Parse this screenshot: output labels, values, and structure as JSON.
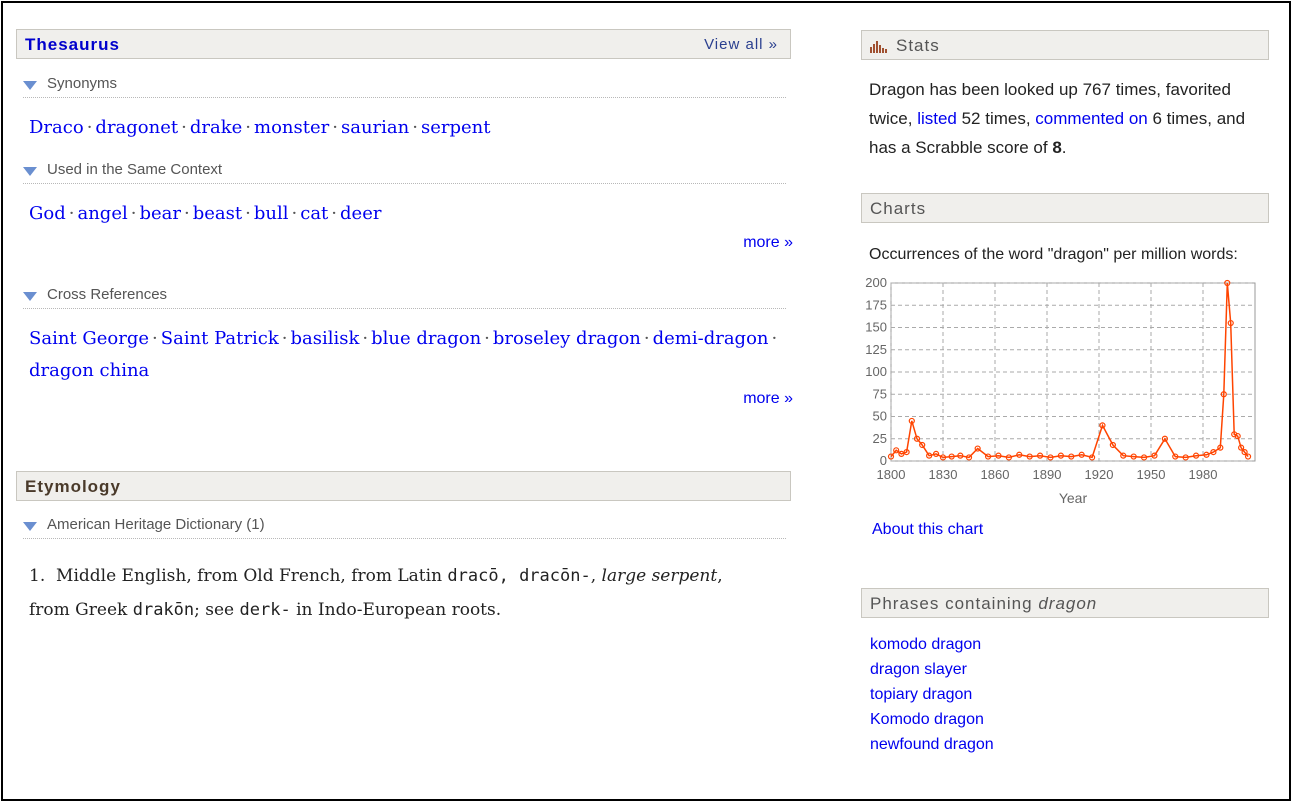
{
  "thesaurus": {
    "title": "Thesaurus",
    "view_all": "View all »",
    "synonyms_label": "Synonyms",
    "synonyms": [
      "Draco",
      "dragonet",
      "drake",
      "monster",
      "saurian",
      "serpent"
    ],
    "context_label": "Used in the Same Context",
    "context": [
      "God",
      "angel",
      "bear",
      "beast",
      "bull",
      "cat",
      "deer"
    ],
    "more_label": "more »",
    "xref_label": "Cross References",
    "xref_line1": [
      "Saint George",
      "Saint Patrick",
      "basilisk",
      "blue dragon",
      "broseley dragon",
      "demi-dragon"
    ],
    "xref_line2": [
      "dragon china"
    ],
    "more_label_2": "more »"
  },
  "etymology": {
    "title": "Etymology",
    "source_label": "American Heritage Dictionary (1)",
    "item_number": "1.",
    "part1": "Middle English, from Old French, from Latin ",
    "latin": "dracō, dracōn-",
    "part2": ", ",
    "gloss": "large serpent",
    "part3": ", from Greek ",
    "greek": "drakōn",
    "part4": "; see ",
    "root": "derk-",
    "part5": " in Indo-European roots."
  },
  "stats": {
    "title": "Stats",
    "text1": "Dragon has been looked up 767 times, favorited twice, ",
    "listed_link": "listed",
    "text2": " 52 times, ",
    "commented_link": "commented on",
    "text3": " 6 times, and has a Scrabble score of ",
    "score": "8",
    "text4": "."
  },
  "charts": {
    "title": "Charts",
    "caption": "Occurrences of the word \"dragon\" per million words:",
    "about_link": "About this chart"
  },
  "phrases": {
    "title_prefix": "Phrases containing ",
    "title_word": "dragon",
    "items": [
      "komodo dragon",
      "dragon slayer",
      "topiary dragon",
      "Komodo dragon",
      "newfound dragon"
    ]
  },
  "colors": {
    "link": "#0000ee",
    "chart_line": "#ff4400",
    "header_bg": "#f0efec"
  },
  "chart_data": {
    "type": "line",
    "xlabel": "Year",
    "ylabel": "",
    "xlim": [
      1800,
      2010
    ],
    "ylim": [
      0,
      200
    ],
    "xticks": [
      1800,
      1830,
      1860,
      1890,
      1920,
      1950,
      1980
    ],
    "yticks": [
      0,
      25,
      50,
      75,
      100,
      125,
      150,
      175,
      200
    ],
    "grid": true,
    "series": [
      {
        "x": [
          1800,
          1803,
          1806,
          1809,
          1812,
          1815,
          1818,
          1822,
          1826,
          1830,
          1835,
          1840,
          1845,
          1850,
          1856,
          1862,
          1868,
          1874,
          1880,
          1886,
          1892,
          1898,
          1904,
          1910,
          1916,
          1922,
          1928,
          1934,
          1940,
          1946,
          1952,
          1958,
          1964,
          1970,
          1976,
          1982,
          1986,
          1990,
          1992,
          1994,
          1996,
          1998,
          2000,
          2002,
          2004,
          2006
        ],
        "values": [
          5,
          12,
          8,
          10,
          45,
          25,
          18,
          6,
          8,
          4,
          5,
          6,
          4,
          14,
          5,
          6,
          4,
          7,
          5,
          6,
          4,
          6,
          5,
          7,
          4,
          40,
          18,
          6,
          5,
          4,
          6,
          25,
          5,
          4,
          6,
          7,
          10,
          15,
          75,
          200,
          155,
          30,
          28,
          15,
          10,
          5
        ]
      }
    ]
  }
}
